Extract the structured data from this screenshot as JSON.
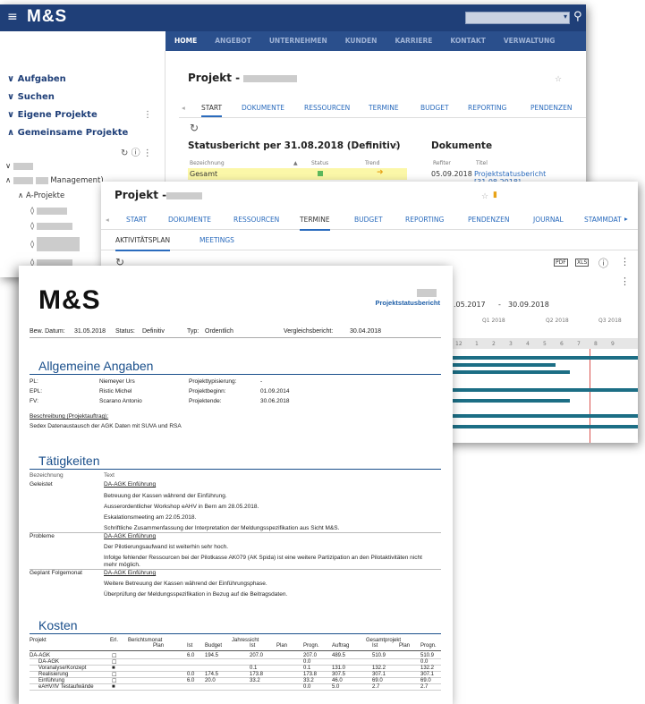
{
  "app": {
    "logo": "M&S",
    "menu_icon": "hamburger-icon",
    "search_icon": "search-icon"
  },
  "nav": {
    "items": [
      "HOME",
      "ANGEBOT",
      "UNTERNEHMEN",
      "KUNDEN",
      "KARRIERE",
      "KONTAKT",
      "VERWALTUNG"
    ]
  },
  "sidebar": {
    "aufgaben": "Aufgaben",
    "suchen": "Suchen",
    "eigene": "Eigene Projekte",
    "gemeinsame": "Gemeinsame Projekte",
    "management": "Management)",
    "a_projekte": "A-Projekte"
  },
  "window1": {
    "title": "Projekt -",
    "tabs": [
      "START",
      "DOKUMENTE",
      "RESSOURCEN",
      "TERMINE",
      "BUDGET",
      "REPORTING",
      "PENDENZEN"
    ],
    "status_title": "Statusbericht per 31.08.2018 (Definitiv)",
    "status_cols": [
      "Bezeichnung",
      "Status",
      "Trend"
    ],
    "status_row": "Gesamt",
    "docs_title": "Dokumente",
    "docs_cols": [
      "Refiter",
      "Titel"
    ],
    "doc_date": "05.09.2018",
    "doc_title": "Projektstatusbericht [31.08.2018]"
  },
  "window2": {
    "title": "Projekt -",
    "tabs": [
      "START",
      "DOKUMENTE",
      "RESSOURCEN",
      "TERMINE",
      "BUDGET",
      "REPORTING",
      "PENDENZEN",
      "JOURNAL",
      "STAMMDAT"
    ],
    "subtabs": [
      "AKTIVITÄTSPLAN",
      "MEETINGS"
    ],
    "date_from": ".05.2017",
    "date_sep": "-",
    "date_to": "30.09.2018",
    "quarters": [
      "Q1 2018",
      "Q2 2018",
      "Q3 2018"
    ],
    "months": [
      "12",
      "1",
      "2",
      "3",
      "4",
      "5",
      "6",
      "7",
      "8",
      "9"
    ],
    "pdf": "PDF",
    "xls": "XLS"
  },
  "doc": {
    "logo": "M&S",
    "header": "Projektstatusbericht",
    "meta": {
      "bew_label": "Bew. Datum:",
      "bew_value": "31.05.2018",
      "status_label": "Status:",
      "status_value": "Definitiv",
      "typ_label": "Typ:",
      "typ_value": "Ordentlich",
      "vergl_label": "Vergleichsbericht:",
      "vergl_value": "30.04.2018"
    },
    "allgemeine": "Allgemeine Angaben",
    "pl_label": "PL:",
    "pl_value": "Niemeyer Urs",
    "epl_label": "EPL:",
    "epl_value": "Ristic Michel",
    "fv_label": "FV:",
    "fv_value": "Scarano Antonio",
    "typisierung_label": "Projekttypisierung:",
    "typisierung_value": "-",
    "beginn_label": "Projektbeginn:",
    "beginn_value": "01.09.2014",
    "ende_label": "Projektende:",
    "ende_value": "30.06.2018",
    "beschreibung_label": "Beschreibung (Projektauftrag):",
    "beschreibung_value": "Sedex Datenaustausch der AGK Daten mit SUVA und RSA",
    "taetigkeiten": "Tätigkeiten",
    "t_col1": "Bezeichnung",
    "t_col2": "Text",
    "geleistet": "Geleistet",
    "g1": "DA-AGK Einführung",
    "g2": "Betreuung der Kassen während der Einführung.",
    "g3": "Ausserordentlicher Workshop eAHV in Bern am 28.05.2018.",
    "g4": "Eskalationsmeeting am 22.05.2018.",
    "g5": "Schriftliche Zusammenfassung der Interpretation der Meldungsspezifikation aus Sicht M&S.",
    "probleme": "Probleme",
    "p1": "DA-AGK Einführung",
    "p2": "Der Pilotierungsaufwand ist weiterhin sehr hoch.",
    "p3": "Infolge fehlender Ressourcen bei der Pilotkasse AK079 (AK Spida) ist eine weitere Partizipation an den Pilotaktivitäten nicht",
    "p4": "mehr möglich.",
    "geplant": "Geplant Folgemonat",
    "f1": "DA-AGK Einführung",
    "f2": "Weitere Betreuung der Kassen während der Einführungsphase.",
    "f3": "Überprüfung der Meldungsspezifikation in Bezug auf die Beitragsdaten.",
    "kosten": "Kosten",
    "k_head1": [
      "Projekt",
      "Erl.",
      "Berichtsmonat",
      "Jahressicht",
      "Gesamtprojekt"
    ],
    "k_head2": [
      "Plan",
      "Ist",
      "Budget",
      "Ist",
      "Plan",
      "Progn.",
      "Auftrag",
      "Ist",
      "Plan",
      "Progn."
    ],
    "rows": [
      {
        "name": "DA-AGK",
        "vals": [
          "6.0",
          "194.5",
          "207.0",
          "",
          "207.0",
          "489.5",
          "510.9",
          "",
          "510.9"
        ]
      },
      {
        "name": "DA-AGK",
        "vals": [
          "",
          "",
          "",
          "",
          "0.0",
          "",
          "",
          "",
          "0.0"
        ]
      },
      {
        "name": "Voranalyse/Konzept",
        "vals": [
          "",
          "",
          "0.1",
          "",
          "0.1",
          "131.0",
          "132.2",
          "",
          "132.2"
        ]
      },
      {
        "name": "Realisierung",
        "vals": [
          "0.0",
          "174.5",
          "173.8",
          "",
          "173.8",
          "307.5",
          "307.1",
          "",
          "307.1"
        ]
      },
      {
        "name": "Einführung",
        "vals": [
          "6.0",
          "20.0",
          "33.2",
          "",
          "33.2",
          "46.0",
          "69.0",
          "",
          "69.0"
        ]
      },
      {
        "name": "eAHV/IV Testaufwände",
        "vals": [
          "",
          "",
          "",
          "",
          "0.0",
          "5.0",
          "2.7",
          "",
          "2.7"
        ]
      }
    ]
  }
}
